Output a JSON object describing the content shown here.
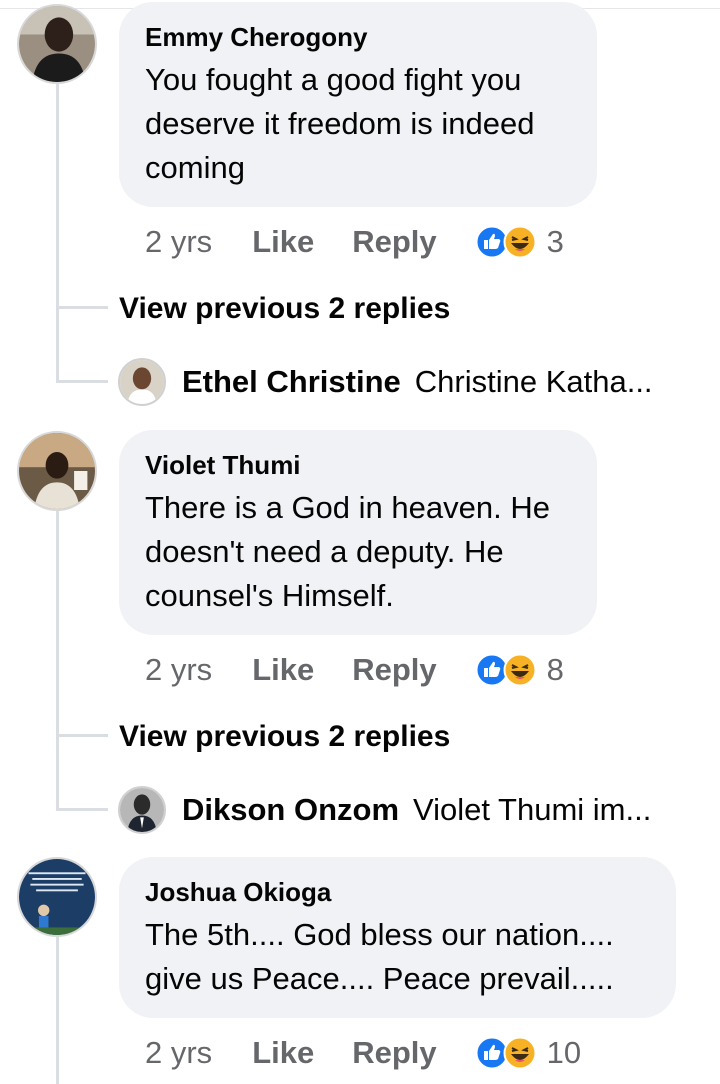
{
  "comments": [
    {
      "author": "Emmy Cherogony",
      "lines": [
        "You fought a good fight you",
        "deserve it freedom is indeed",
        "coming"
      ],
      "time": "2 yrs",
      "like_label": "Like",
      "reply_label": "Reply",
      "reaction_count": "3",
      "view_previous": "View previous 2 replies",
      "latest_reply": {
        "author": "Ethel Christine",
        "preview": "Christine Katha..."
      }
    },
    {
      "author": "Violet Thumi",
      "lines": [
        "There is a God in heaven. He",
        "doesn't need a deputy. He",
        "counsel's Himself."
      ],
      "time": "2 yrs",
      "like_label": "Like",
      "reply_label": "Reply",
      "reaction_count": "8",
      "view_previous": "View previous 2 replies",
      "latest_reply": {
        "author": "Dikson Onzom",
        "preview": "Violet Thumi im..."
      }
    },
    {
      "author": "Joshua Okioga",
      "lines": [
        "The 5th.... God bless our nation....",
        "give us Peace.... Peace prevail....."
      ],
      "time": "2 yrs",
      "like_label": "Like",
      "reply_label": "Reply",
      "reaction_count": "10"
    }
  ],
  "colors": {
    "bubble": "#f0f2f5",
    "meta_text": "#65676b",
    "like_blue": "#1877f2",
    "haha_yellow": "#f7b125",
    "thread_line": "#dadde1"
  },
  "icons": {
    "like_reaction": "like-reaction-icon",
    "haha_reaction": "haha-reaction-icon"
  }
}
